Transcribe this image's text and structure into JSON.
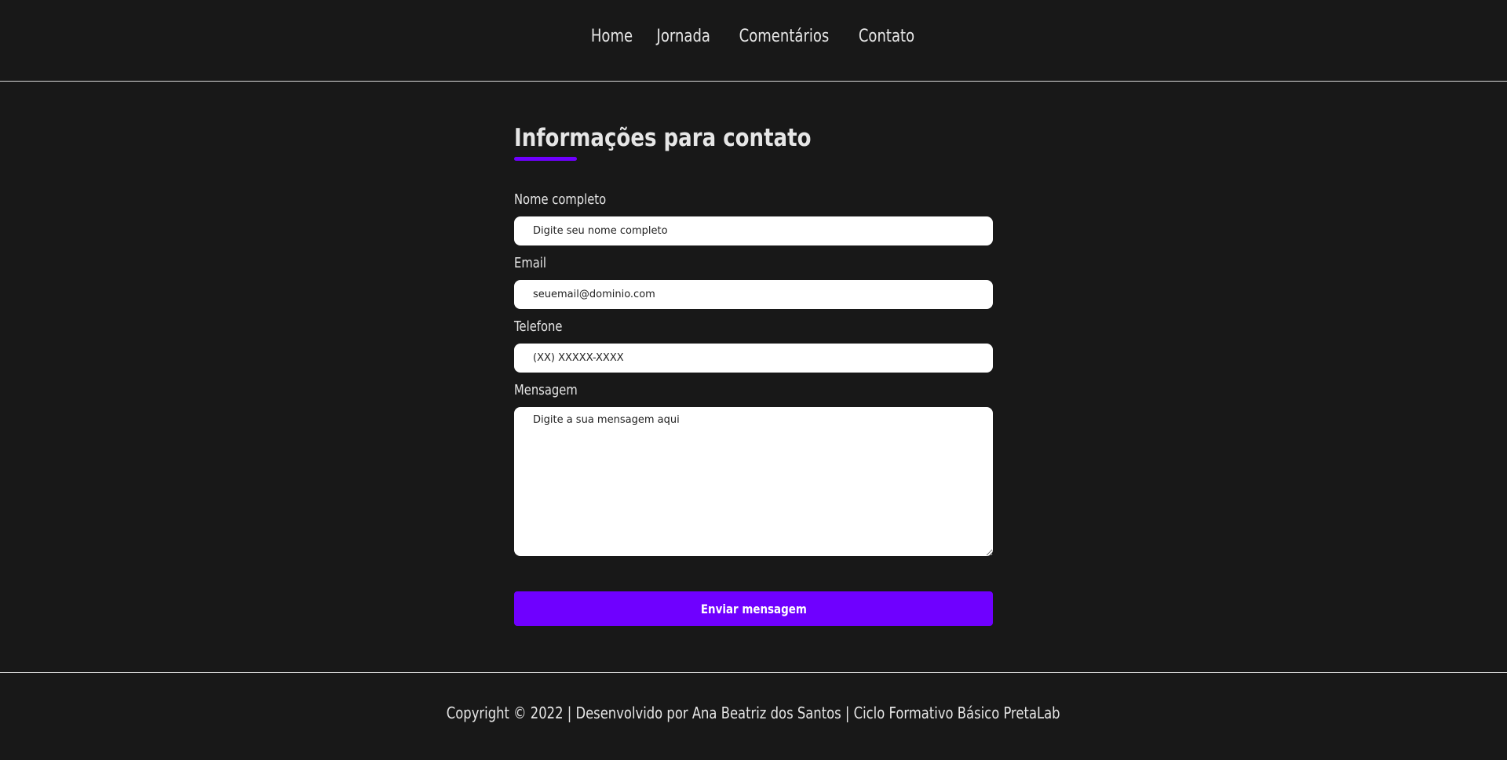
{
  "nav": {
    "items": [
      {
        "label": "Home"
      },
      {
        "label": "Jornada"
      },
      {
        "label": "Comentários"
      },
      {
        "label": "Contato"
      }
    ]
  },
  "main": {
    "title": "Informações para contato",
    "fields": {
      "name": {
        "label": "Nome completo",
        "placeholder": "Digite seu nome completo",
        "value": ""
      },
      "email": {
        "label": "Email",
        "placeholder": "seuemail@dominio.com",
        "value": ""
      },
      "phone": {
        "label": "Telefone",
        "placeholder": "(XX) XXXXX-XXXX",
        "value": ""
      },
      "message": {
        "label": "Mensagem",
        "placeholder": "Digite a sua mensagem aqui",
        "value": ""
      }
    },
    "submit_label": "Enviar mensagem"
  },
  "footer": {
    "text": "Copyright © 2022 | Desenvolvido por Ana Beatriz dos Santos | Ciclo Formativo Básico PretaLab"
  },
  "colors": {
    "background": "#181818",
    "accent": "#6f00ff",
    "text": "#e6e6e6",
    "divider": "#d9d9d9"
  }
}
